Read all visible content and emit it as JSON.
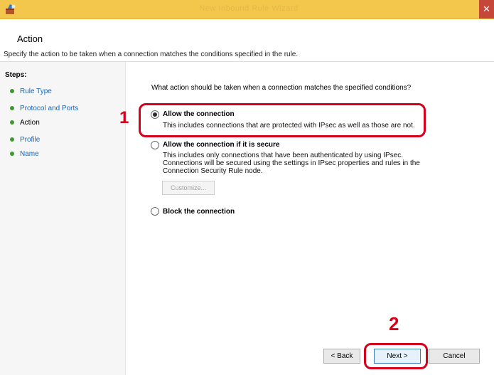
{
  "window": {
    "title": "New Inbound Rule Wizard",
    "close_glyph": "✕"
  },
  "header": {
    "title": "Action",
    "subtitle": "Specify the action to be taken when a connection matches the conditions specified in the rule."
  },
  "sidebar": {
    "steps_label": "Steps:",
    "items": [
      {
        "label": "Rule Type"
      },
      {
        "label": "Protocol and Ports"
      },
      {
        "label": "Action"
      },
      {
        "label": "Profile"
      },
      {
        "label": "Name"
      }
    ]
  },
  "main": {
    "question": "What action should be taken when a connection matches the specified conditions?",
    "options": [
      {
        "label": "Allow the connection",
        "description": "This includes connections that are protected with IPsec as well as those are not.",
        "selected": true
      },
      {
        "label": "Allow the connection if it is secure",
        "description_lines": [
          "This includes only connections that have been authenticated by using IPsec.",
          "Connections will be secured using the settings in IPsec properties and rules in the",
          "Connection Security Rule node."
        ],
        "selected": false
      },
      {
        "label": "Block the connection",
        "selected": false
      }
    ],
    "customize_label": "Customize..."
  },
  "footer": {
    "back_label": "< Back",
    "next_label": "Next >",
    "cancel_label": "Cancel"
  },
  "annotations": {
    "callout_1": "1",
    "callout_2": "2",
    "color": "#d6001c"
  }
}
